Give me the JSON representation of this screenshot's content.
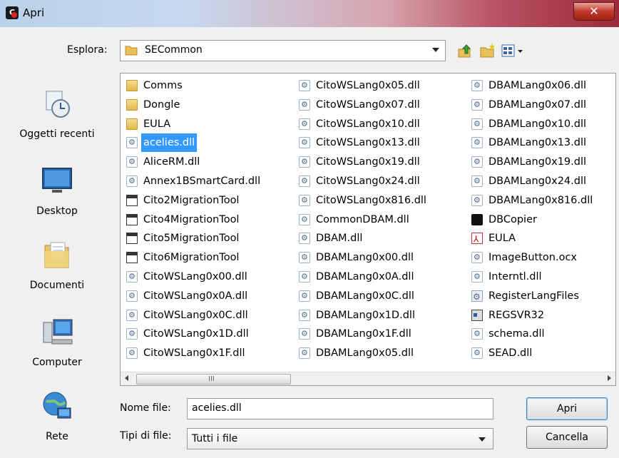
{
  "window": {
    "title": "Apri",
    "close_glyph": "✕"
  },
  "lookin": {
    "label": "Esplora:",
    "value": "SECommon"
  },
  "places": [
    {
      "label": "Oggetti recenti",
      "icon": "recent-items-icon"
    },
    {
      "label": "Desktop",
      "icon": "desktop-icon"
    },
    {
      "label": "Documenti",
      "icon": "documents-icon"
    },
    {
      "label": "Computer",
      "icon": "computer-icon"
    },
    {
      "label": "Rete",
      "icon": "network-icon"
    }
  ],
  "files": {
    "columns": [
      [
        {
          "name": "Comms",
          "type": "folder"
        },
        {
          "name": "Dongle",
          "type": "folder"
        },
        {
          "name": "EULA",
          "type": "folder"
        },
        {
          "name": "acelies.dll",
          "type": "dll",
          "selected": true
        },
        {
          "name": "AliceRM.dll",
          "type": "dll"
        },
        {
          "name": "Annex1BSmartCard.dll",
          "type": "dll"
        },
        {
          "name": "Cito2MigrationTool",
          "type": "app"
        },
        {
          "name": "Cito4MigrationTool",
          "type": "app"
        },
        {
          "name": "Cito5MigrationTool",
          "type": "app"
        },
        {
          "name": "Cito6MigrationTool",
          "type": "app"
        },
        {
          "name": "CitoWSLang0x00.dll",
          "type": "dll"
        },
        {
          "name": "CitoWSLang0x0A.dll",
          "type": "dll"
        },
        {
          "name": "CitoWSLang0x0C.dll",
          "type": "dll"
        },
        {
          "name": "CitoWSLang0x1D.dll",
          "type": "dll"
        },
        {
          "name": "CitoWSLang0x1F.dll",
          "type": "dll"
        }
      ],
      [
        {
          "name": "CitoWSLang0x05.dll",
          "type": "dll"
        },
        {
          "name": "CitoWSLang0x07.dll",
          "type": "dll"
        },
        {
          "name": "CitoWSLang0x10.dll",
          "type": "dll"
        },
        {
          "name": "CitoWSLang0x13.dll",
          "type": "dll"
        },
        {
          "name": "CitoWSLang0x19.dll",
          "type": "dll"
        },
        {
          "name": "CitoWSLang0x24.dll",
          "type": "dll"
        },
        {
          "name": "CitoWSLang0x816.dll",
          "type": "dll"
        },
        {
          "name": "CommonDBAM.dll",
          "type": "dll"
        },
        {
          "name": "DBAM.dll",
          "type": "dll"
        },
        {
          "name": "DBAMLang0x00.dll",
          "type": "dll"
        },
        {
          "name": "DBAMLang0x0A.dll",
          "type": "dll"
        },
        {
          "name": "DBAMLang0x0C.dll",
          "type": "dll"
        },
        {
          "name": "DBAMLang0x1D.dll",
          "type": "dll"
        },
        {
          "name": "DBAMLang0x1F.dll",
          "type": "dll"
        },
        {
          "name": "DBAMLang0x05.dll",
          "type": "dll"
        }
      ],
      [
        {
          "name": "DBAMLang0x06.dll",
          "type": "dll"
        },
        {
          "name": "DBAMLang0x07.dll",
          "type": "dll"
        },
        {
          "name": "DBAMLang0x10.dll",
          "type": "dll"
        },
        {
          "name": "DBAMLang0x13.dll",
          "type": "dll"
        },
        {
          "name": "DBAMLang0x19.dll",
          "type": "dll"
        },
        {
          "name": "DBAMLang0x24.dll",
          "type": "dll"
        },
        {
          "name": "DBAMLang0x816.dll",
          "type": "dll"
        },
        {
          "name": "DBCopier",
          "type": "copy"
        },
        {
          "name": "EULA",
          "type": "pdf"
        },
        {
          "name": "ImageButton.ocx",
          "type": "dll"
        },
        {
          "name": "Interntl.dll",
          "type": "dll"
        },
        {
          "name": "RegisterLangFiles",
          "type": "reg"
        },
        {
          "name": "REGSVR32",
          "type": "exe"
        },
        {
          "name": "schema.dll",
          "type": "dll"
        },
        {
          "name": "SEAD.dll",
          "type": "dll"
        }
      ]
    ],
    "scroll_grip": "III"
  },
  "filename": {
    "label": "Nome file:",
    "value": "acelies.dll"
  },
  "filetype": {
    "label": "Tipi di file:",
    "value": "Tutti i file"
  },
  "buttons": {
    "open": "Apri",
    "cancel": "Cancella"
  }
}
